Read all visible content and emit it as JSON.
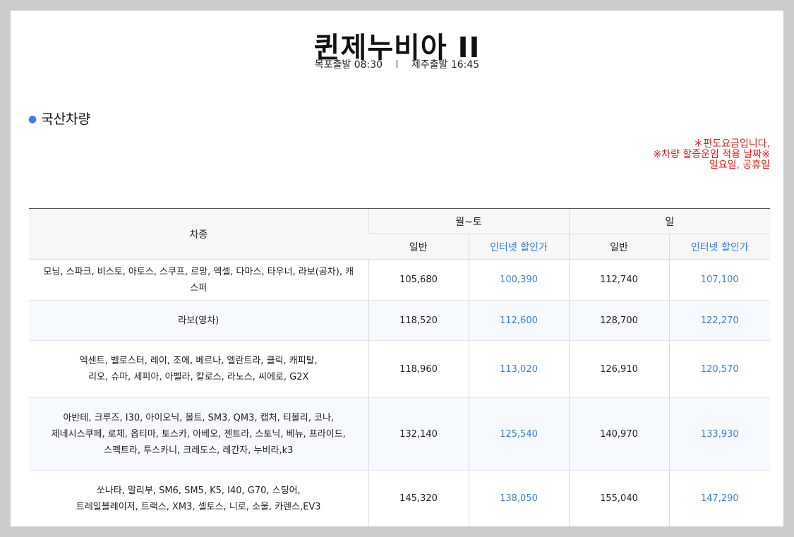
{
  "header": {
    "title": "퀸제누비아 II",
    "depart_mokpo": "목포출발 08:30",
    "separator": "l",
    "depart_jeju": "제주출발 16:45"
  },
  "section_title": "국산차량",
  "notes": [
    "＊편도요금입니다.",
    "※차량 할증운임 적용 날짜※",
    "일요일, 공휴일"
  ],
  "table": {
    "col_vehicle": "차종",
    "group_weekday": "월~토",
    "group_sunday": "일",
    "sub_regular": "일반",
    "sub_internet": "인터넷 할인가",
    "rows": [
      {
        "vehicles": [
          "모닝, 스파크, 비스토, 아토스, 스쿠프, 르망, 엑셀, 다마스, 타우너, 라보(공차), 캐스퍼"
        ],
        "weekday_regular": "105,680",
        "weekday_internet": "100,390",
        "sunday_regular": "112,740",
        "sunday_internet": "107,100"
      },
      {
        "vehicles": [
          "라보(영차)"
        ],
        "weekday_regular": "118,520",
        "weekday_internet": "112,600",
        "sunday_regular": "128,700",
        "sunday_internet": "122,270"
      },
      {
        "vehicles": [
          "엑센트, 벨로스터, 레이, 조에, 베르나, 엘란트라, 클릭, 캐피탈,",
          "리오, 슈마, 세피아, 아벨라, 칼로스, 라노스, 씨에로, G2X"
        ],
        "weekday_regular": "118,960",
        "weekday_internet": "113,020",
        "sunday_regular": "126,910",
        "sunday_internet": "120,570"
      },
      {
        "vehicles": [
          "아반테, 크루즈, I30, 아이오닉, 볼트, SM3, QM3, 캡처, 티볼리, 코나,",
          "제네시스쿠페, 로체, 옵티마, 토스카, 아베오, 젠트라, 스토닉, 베뉴, 프라이드,",
          "스펙트라, 투스카니, 크레도스, 레간자, 누비라,k3"
        ],
        "weekday_regular": "132,140",
        "weekday_internet": "125,540",
        "sunday_regular": "140,970",
        "sunday_internet": "133,930"
      },
      {
        "vehicles": [
          "쏘나타, 말리부, SM6, SM5, K5, I40, G70, 스팅어,",
          "트레일블레이저, 트랙스, XM3, 셀토스, 니로, 소울, 카렌스,EV3"
        ],
        "weekday_regular": "145,320",
        "weekday_internet": "138,050",
        "sunday_regular": "155,040",
        "sunday_internet": "147,290"
      }
    ]
  }
}
